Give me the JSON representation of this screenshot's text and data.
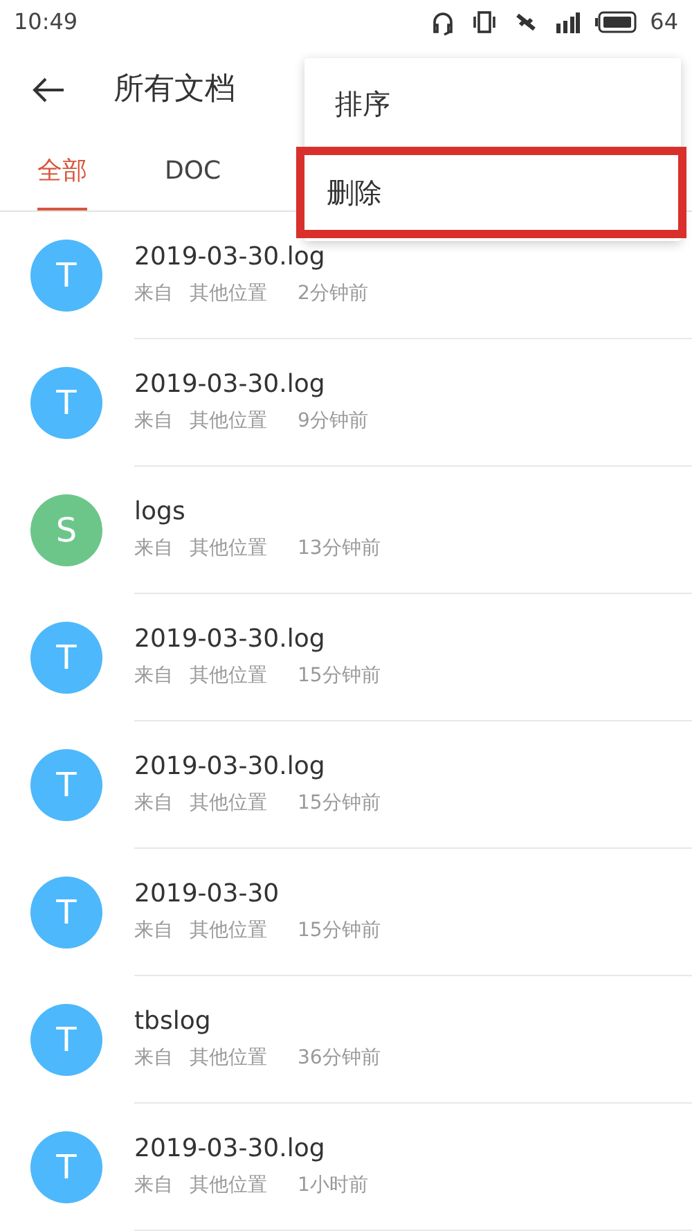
{
  "status_bar": {
    "time": "10:49",
    "battery": "64"
  },
  "header": {
    "title": "所有文档"
  },
  "tabs": [
    {
      "label": "全部",
      "selected": true
    },
    {
      "label": "DOC",
      "selected": false
    }
  ],
  "menu": {
    "items": [
      {
        "label": "排序",
        "highlighted": false
      },
      {
        "label": "删除",
        "highlighted": true
      }
    ]
  },
  "files": [
    {
      "avatar": "T",
      "color": "#4db8fb",
      "name": "2019-03-30.log",
      "from": "来自",
      "location": "其他位置",
      "time": "2分钟前"
    },
    {
      "avatar": "T",
      "color": "#4db8fb",
      "name": "2019-03-30.log",
      "from": "来自",
      "location": "其他位置",
      "time": "9分钟前"
    },
    {
      "avatar": "S",
      "color": "#6cc68a",
      "name": "logs",
      "from": "来自",
      "location": "其他位置",
      "time": "13分钟前"
    },
    {
      "avatar": "T",
      "color": "#4db8fb",
      "name": "2019-03-30.log",
      "from": "来自",
      "location": "其他位置",
      "time": "15分钟前"
    },
    {
      "avatar": "T",
      "color": "#4db8fb",
      "name": "2019-03-30.log",
      "from": "来自",
      "location": "其他位置",
      "time": "15分钟前"
    },
    {
      "avatar": "T",
      "color": "#4db8fb",
      "name": "2019-03-30",
      "from": "来自",
      "location": "其他位置",
      "time": "15分钟前"
    },
    {
      "avatar": "T",
      "color": "#4db8fb",
      "name": "tbslog",
      "from": "来自",
      "location": "其他位置",
      "time": "36分钟前"
    },
    {
      "avatar": "T",
      "color": "#4db8fb",
      "name": "2019-03-30.log",
      "from": "来自",
      "location": "其他位置",
      "time": "1小时前"
    }
  ]
}
